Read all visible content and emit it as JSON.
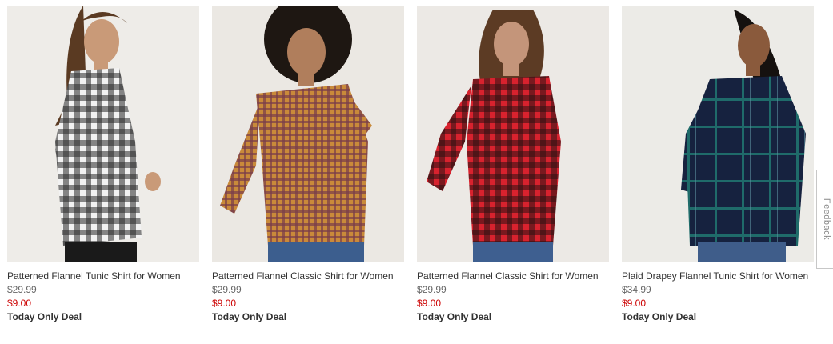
{
  "products": [
    {
      "title": "Patterned Flannel Tunic Shirt for Women",
      "was_price": "$29.99",
      "price": "$9.00",
      "deal": "Today Only Deal",
      "shirt_color": "#2a2a2a",
      "check_color": "#f2f2f2",
      "bg_color": "#eeece8"
    },
    {
      "title": "Patterned Flannel Classic Shirt for Women",
      "was_price": "$29.99",
      "price": "$9.00",
      "deal": "Today Only Deal",
      "shirt_color": "#c98a3a",
      "check_color": "#7a3d4a",
      "bg_color": "#ebe8e3"
    },
    {
      "title": "Patterned Flannel Classic Shirt for Women",
      "was_price": "$29.99",
      "price": "$9.00",
      "deal": "Today Only Deal",
      "shirt_color": "#d8222e",
      "check_color": "#2b1212",
      "bg_color": "#ece9e5"
    },
    {
      "title": "Plaid Drapey Flannel Tunic Shirt for Women",
      "was_price": "$34.99",
      "price": "$9.00",
      "deal": "Today Only Deal",
      "shirt_color": "#16223f",
      "check_color": "#1f6b6a",
      "bg_color": "#ecebe7"
    }
  ],
  "feedback_tab": {
    "label": "Feedback"
  }
}
